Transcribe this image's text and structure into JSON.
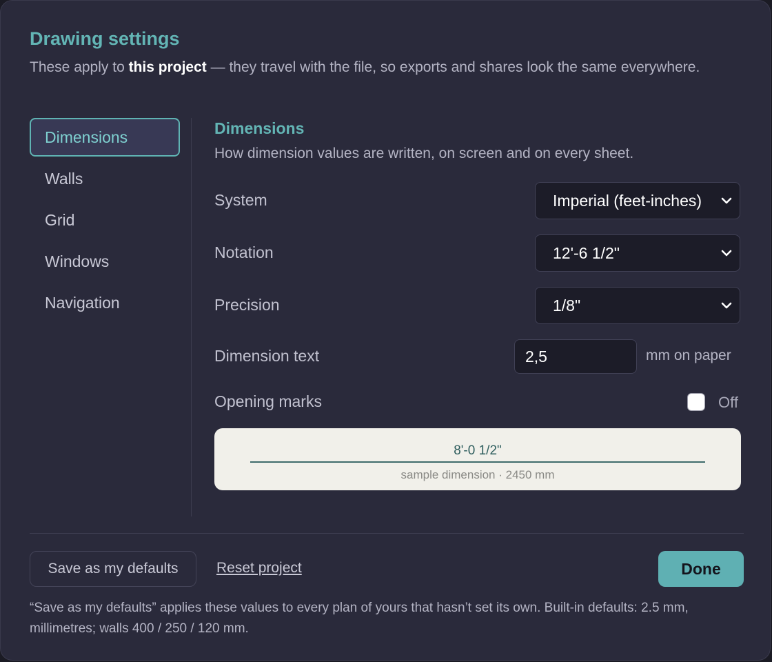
{
  "header": {
    "title": "Drawing settings",
    "subtitle_pre": "These apply to ",
    "subtitle_bold": "this project",
    "subtitle_post": " — they travel with the file, so exports and shares look the same everywhere."
  },
  "sidebar": {
    "items": [
      {
        "label": "Dimensions",
        "active": true
      },
      {
        "label": "Walls"
      },
      {
        "label": "Grid"
      },
      {
        "label": "Windows"
      },
      {
        "label": "Navigation"
      }
    ]
  },
  "section": {
    "title": "Dimensions",
    "description": "How dimension values are written, on screen and on every sheet."
  },
  "fields": {
    "system": {
      "label": "System",
      "value": "Imperial (feet-inches)"
    },
    "notation": {
      "label": "Notation",
      "value": "12'-6 1/2\""
    },
    "precision": {
      "label": "Precision",
      "value": "1/8\""
    },
    "dimension_text": {
      "label": "Dimension text",
      "value": "2,5",
      "unit": "mm on paper"
    },
    "opening_marks": {
      "label": "Opening marks",
      "state_label": "Off",
      "checked": false
    }
  },
  "preview": {
    "dimension": "8'-0 1/2\"",
    "caption": "sample dimension · 2450 mm"
  },
  "footer": {
    "save_defaults_label": "Save as my defaults",
    "reset_label": "Reset project",
    "done_label": "Done",
    "note": "“Save as my defaults” applies these values to every plan of yours that hasn’t set its own. Built-in defaults: 2.5 mm, millimetres; walls 400 / 250 / 120 mm."
  },
  "colors": {
    "accent": "#5fb3b3",
    "background": "#2a2a3b",
    "primary_button": "#5fb0b3"
  }
}
